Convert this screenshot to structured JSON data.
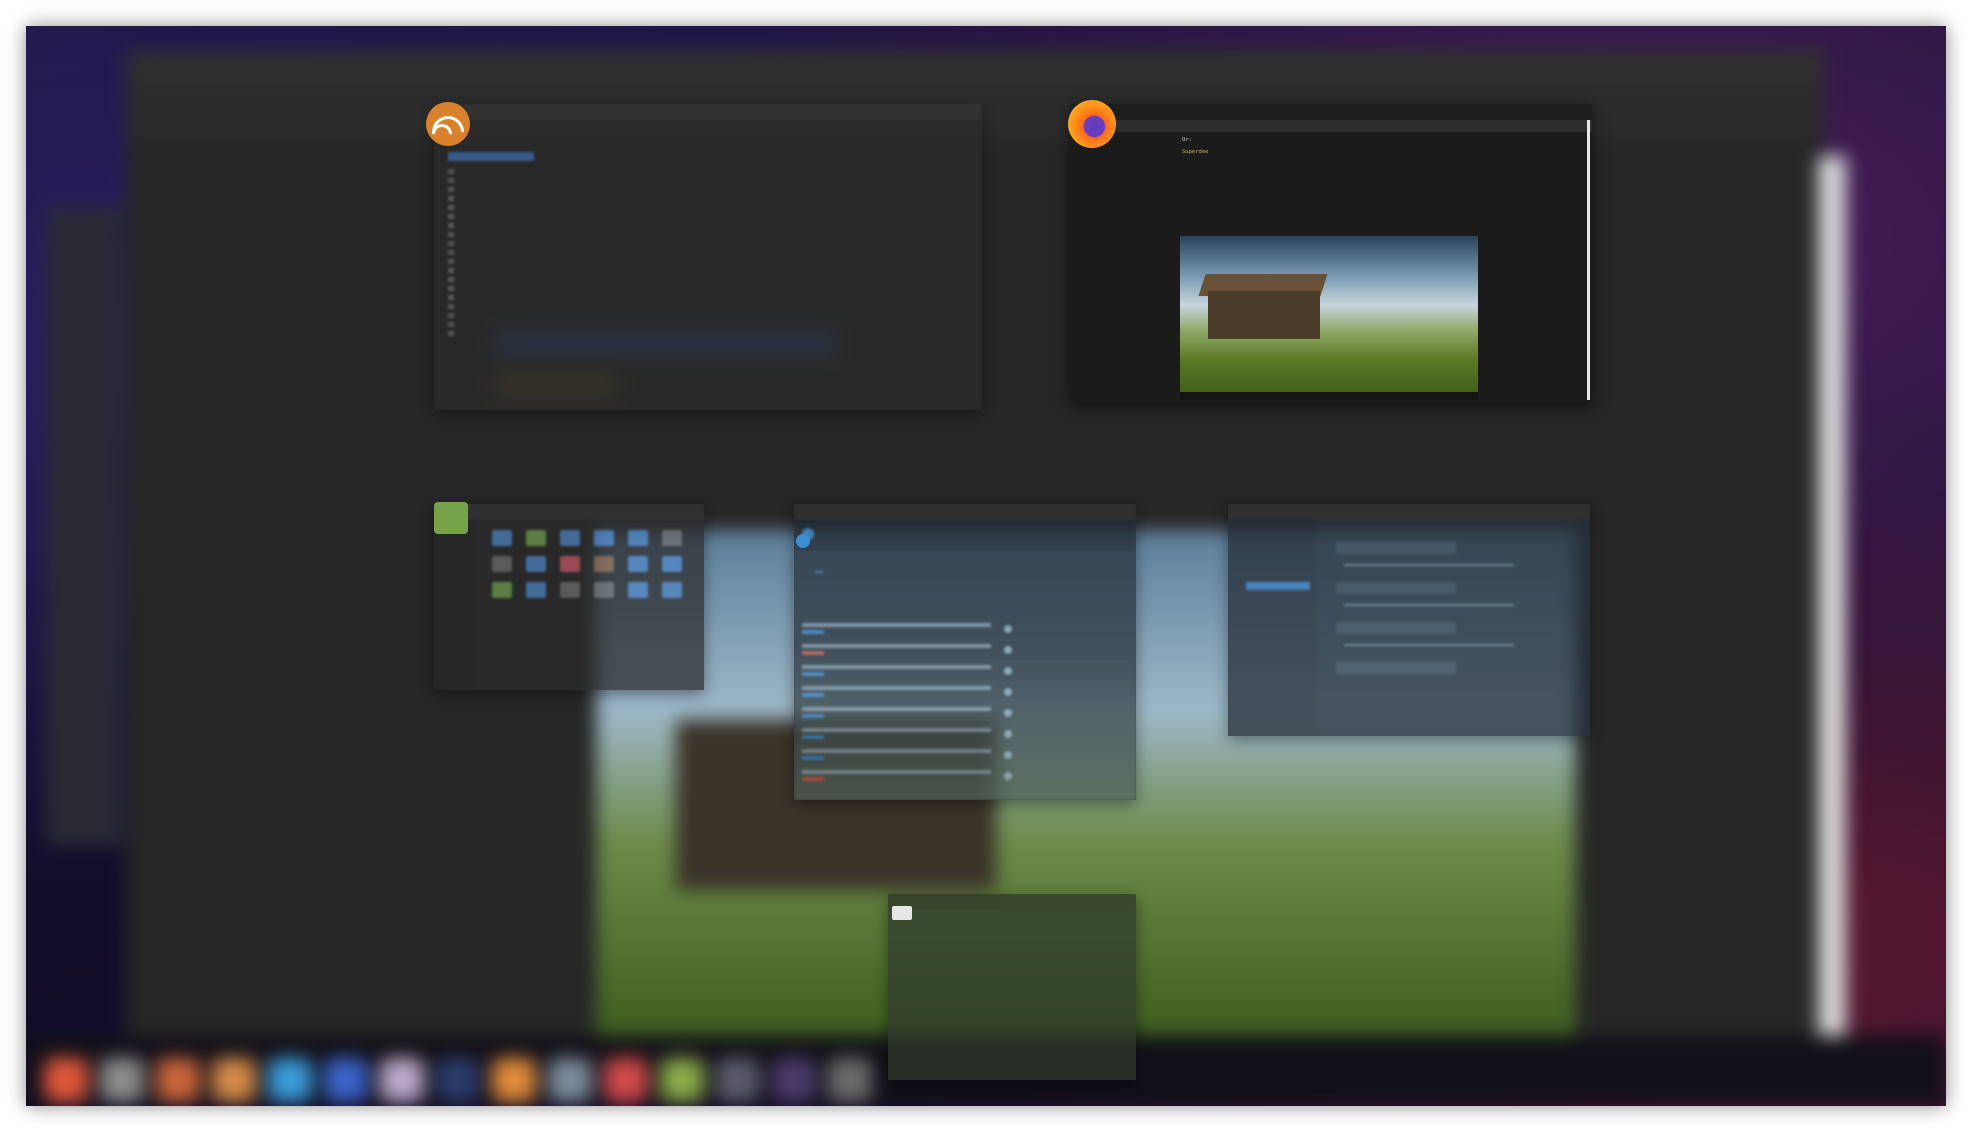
{
  "windows": {
    "feed_reader": {
      "title": "",
      "active_feed": "",
      "feeds": [
        "",
        "",
        "",
        "",
        "",
        "",
        "",
        "",
        "",
        "",
        "",
        "",
        "",
        "",
        "",
        "",
        "",
        "",
        ""
      ],
      "center_text": "",
      "right_text": ""
    },
    "firefox": {
      "title": "",
      "lines": [
        {
          "text": "",
          "link": ""
        },
        {
          "text": "",
          "link": ""
        },
        {
          "text": "",
          "link": ""
        }
      ],
      "notes": [
        "Or: ",
        "",
        "Superdee"
      ]
    },
    "files": {
      "title": ""
    },
    "forum": {
      "title": "",
      "logo_text": "",
      "tabs": [
        "",
        "",
        "",
        "",
        "",
        "",
        ""
      ]
    },
    "music": {
      "title": "",
      "channel": ""
    },
    "terminal": {
      "title": "",
      "prompt": ""
    }
  },
  "icons": {
    "feed_reader": "rss-icon",
    "firefox": "firefox-icon",
    "files": "folder-icon",
    "forum": "forum-logo-icon",
    "terminal": "terminal-icon"
  },
  "colors": {
    "accent": "#3a7fc4",
    "rss": "#d9822b",
    "firefox": "#ff8a1a"
  }
}
